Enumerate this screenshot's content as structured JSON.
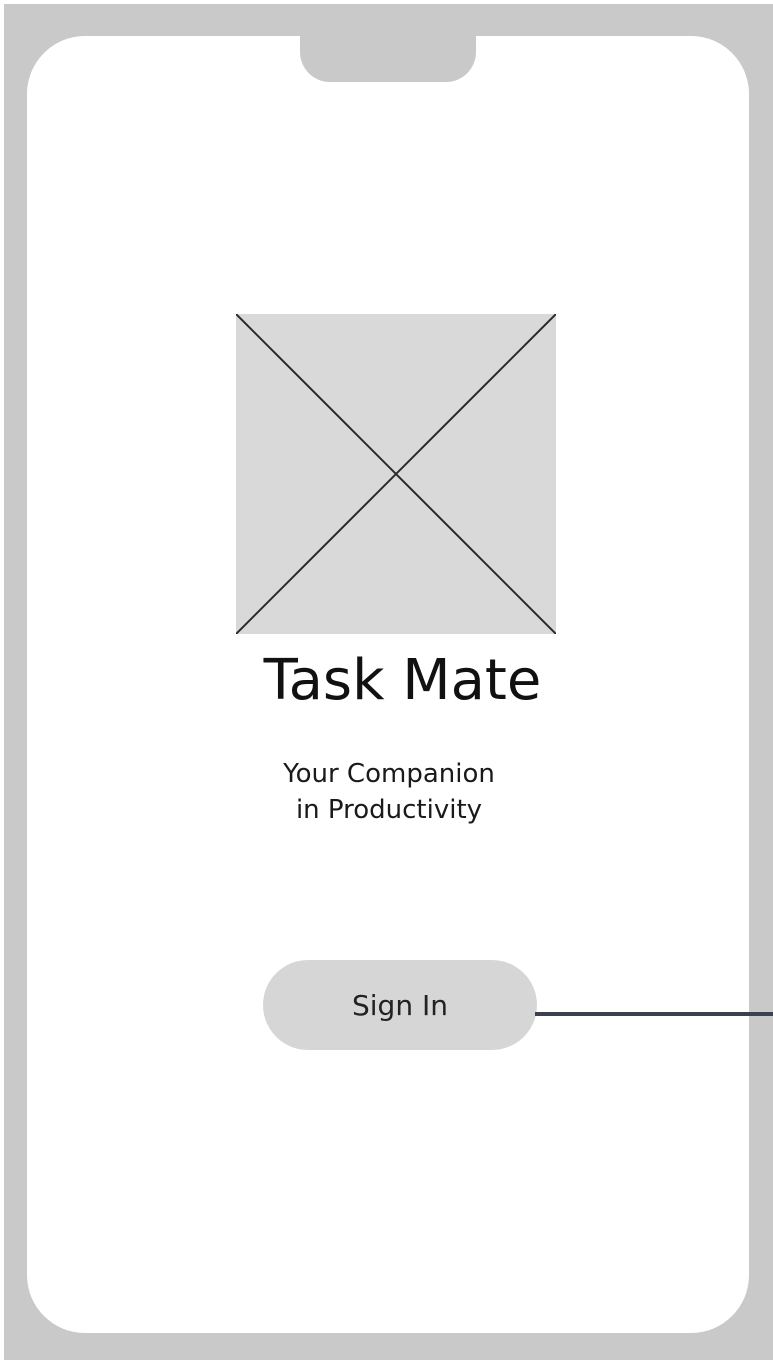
{
  "app": {
    "title": "Task Mate",
    "tagline_line1": "Your Companion",
    "tagline_line2": "in Productivity"
  },
  "actions": {
    "sign_in_label": "Sign In"
  },
  "colors": {
    "frame": "#c9c9c9",
    "screen": "#ffffff",
    "placeholder_fill": "#d9d9d9",
    "placeholder_stroke": "#2a2a2a",
    "button_fill": "#d6d6d6",
    "connector": "#3b4150"
  },
  "icons": {
    "logo": "image-placeholder-icon"
  }
}
